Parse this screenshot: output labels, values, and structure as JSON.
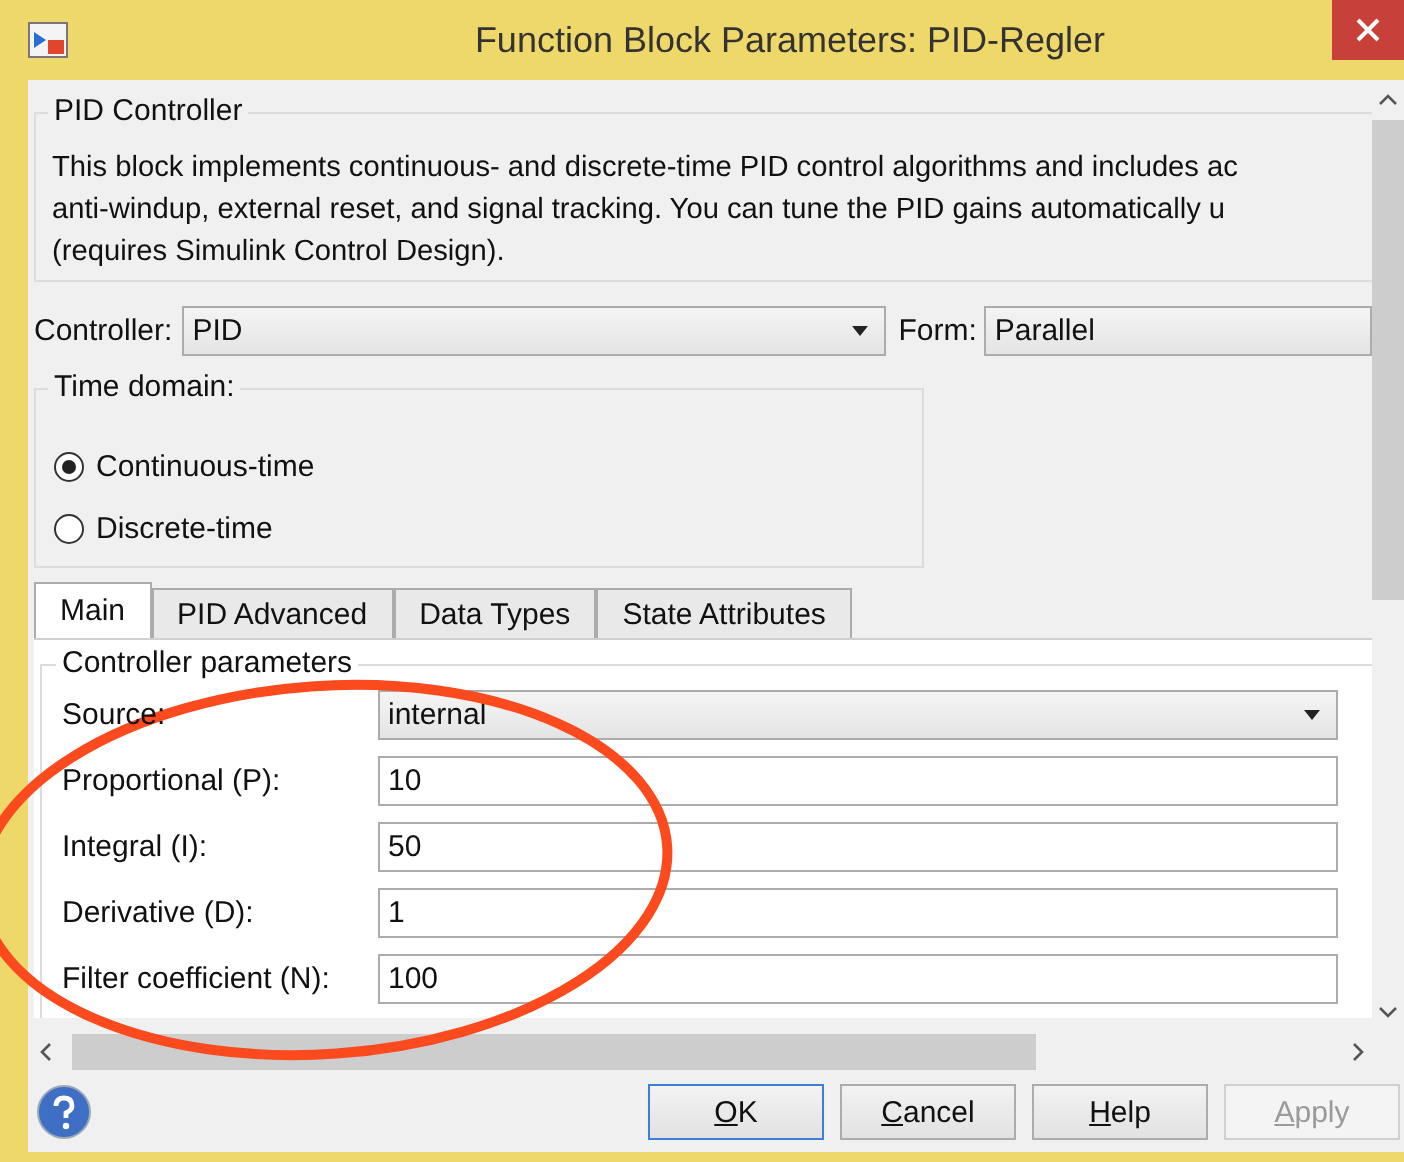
{
  "window": {
    "title": "Function Block Parameters: PID-Regler"
  },
  "description_group": {
    "title": "PID Controller",
    "lines": [
      "This block implements continuous- and discrete-time PID control algorithms and includes ac",
      "anti-windup, external reset, and signal tracking. You can tune the PID gains automatically u",
      "(requires Simulink Control Design)."
    ]
  },
  "controller": {
    "label": "Controller:",
    "value": "PID"
  },
  "form": {
    "label": "Form:",
    "value": "Parallel"
  },
  "time_domain": {
    "title": "Time domain:",
    "options": [
      {
        "label": "Continuous-time",
        "selected": true
      },
      {
        "label": "Discrete-time",
        "selected": false
      }
    ]
  },
  "tabs": [
    {
      "label": "Main",
      "selected": true
    },
    {
      "label": "PID Advanced",
      "selected": false
    },
    {
      "label": "Data Types",
      "selected": false
    },
    {
      "label": "State Attributes",
      "selected": false
    }
  ],
  "parameters": {
    "title": "Controller parameters",
    "rows": [
      {
        "kind": "dropdown",
        "label": "Source:",
        "value": "internal"
      },
      {
        "kind": "text",
        "label": "Proportional (P):",
        "value": "10"
      },
      {
        "kind": "text",
        "label": "Integral (I):",
        "value": "50"
      },
      {
        "kind": "text",
        "label": "Derivative (D):",
        "value": "1"
      },
      {
        "kind": "text",
        "label": "Filter coefficient (N):",
        "value": "100"
      }
    ]
  },
  "buttons": [
    {
      "mnemonic": "O",
      "rest": "K",
      "default": true,
      "disabled": false
    },
    {
      "mnemonic": "C",
      "rest": "ancel",
      "default": false,
      "disabled": false
    },
    {
      "mnemonic": "H",
      "rest": "elp",
      "default": false,
      "disabled": false
    },
    {
      "mnemonic": "A",
      "rest": "pply",
      "default": false,
      "disabled": true
    }
  ],
  "annotation": {
    "kind": "ellipse"
  }
}
